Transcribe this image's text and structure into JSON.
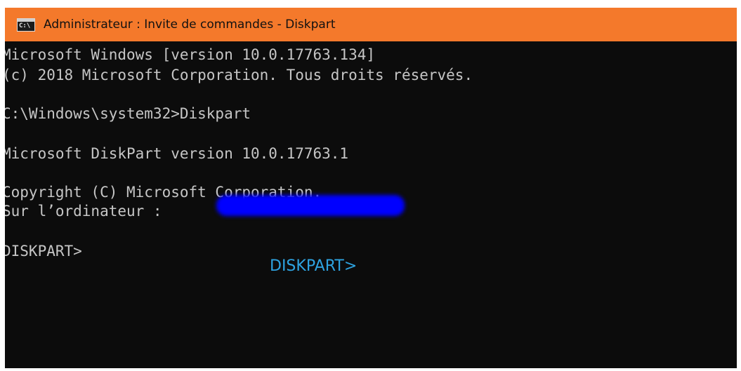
{
  "window": {
    "title": "Administrateur : Invite de commandes - Diskpart",
    "icon": "cmd-icon",
    "titlebar_color": "#f4792b",
    "background_color": "#0c0c0c",
    "text_color": "#c6c6c6"
  },
  "console": {
    "lines": [
      "Microsoft Windows [version 10.0.17763.134]",
      "(c) 2018 Microsoft Corporation. Tous droits réservés.",
      "C:\\Windows\\system32>Diskpart",
      "Microsoft DiskPart version 10.0.17763.1",
      "Copyright (C) Microsoft Corporation.",
      "Sur l’ordinateur : ",
      "DISKPART>"
    ]
  },
  "redaction": {
    "color": "#0000ff"
  },
  "overlay": {
    "caption": "DISKPART>",
    "color": "#2ea3e0"
  }
}
